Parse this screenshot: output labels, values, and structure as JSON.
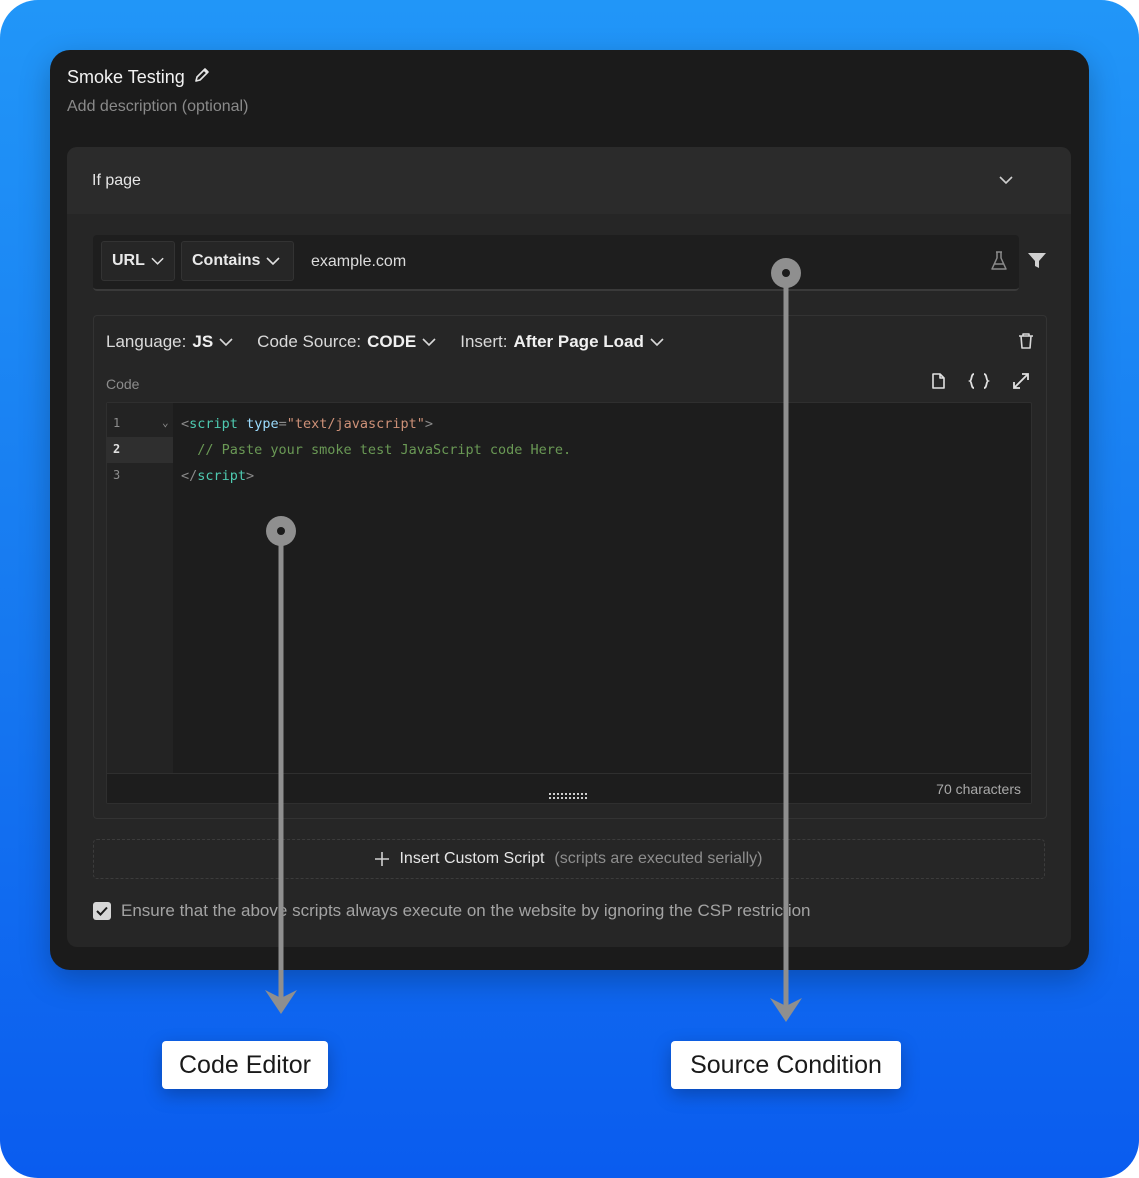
{
  "header": {
    "title": "Smoke Testing",
    "description": "Add description (optional)"
  },
  "rule": {
    "section_label": "If page",
    "condition": {
      "field": "URL",
      "operator": "Contains",
      "value": "example.com"
    }
  },
  "script_config": {
    "language_label": "Language:",
    "language_value": "JS",
    "source_label": "Code Source:",
    "source_value": "CODE",
    "insert_label": "Insert:",
    "insert_value": "After Page Load",
    "code_label": "Code"
  },
  "editor": {
    "line_numbers": [
      "1",
      "2",
      "3"
    ],
    "line1": {
      "open": "<",
      "tag": "script",
      "attr": "type",
      "eq": "=",
      "val": "\"text/javascript\"",
      "close": ">"
    },
    "line2": {
      "comment": "  // Paste your smoke test JavaScript code Here."
    },
    "line3": {
      "open": "</",
      "tag": "script",
      "close": ">"
    },
    "char_count": "70 characters"
  },
  "insert_script": {
    "label": "Insert Custom Script",
    "note": "(scripts are executed serially)"
  },
  "csp": {
    "label": "Ensure that the above scripts always execute on the website by ignoring the CSP restriction",
    "checked": true
  },
  "callouts": {
    "code_editor": "Code Editor",
    "source_condition": "Source Condition"
  },
  "colors": {
    "accent_blue": "#1678f0",
    "card": "#1b1b1b",
    "panel": "#262626"
  }
}
